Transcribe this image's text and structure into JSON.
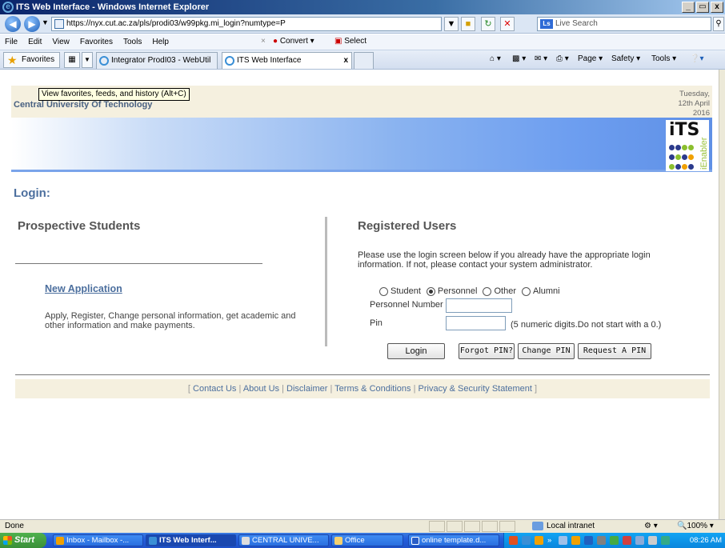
{
  "browser": {
    "title": "ITS Web Interface - Windows Internet Explorer",
    "window_buttons": [
      "_",
      "·",
      "x"
    ],
    "url": "https://nyx.cut.ac.za/pls/prodi03/w99pkg.mi_login?numtype=P",
    "search_placeholder": "Live Search",
    "menu": [
      "File",
      "Edit",
      "View",
      "Favorites",
      "Tools",
      "Help"
    ],
    "convert_label": "Convert",
    "select_label": "Select",
    "favorites_label": "Favorites",
    "tabs": [
      {
        "label": "Integrator ProdI03 - WebUtil"
      },
      {
        "label": "ITS Web Interface"
      }
    ],
    "tab_close": "x",
    "commands": [
      "Page",
      "Safety",
      "Tools"
    ],
    "tooltip": "View favorites, feeds, and history (Alt+C)"
  },
  "header": {
    "university": "Central University Of Technology",
    "date_line1": "Tuesday,",
    "date_line2": "12th April",
    "date_line3": "2016",
    "logo_text": "iTS",
    "logo_side": "iEnabler"
  },
  "login": {
    "title": "Login:",
    "prospective": {
      "title": "Prospective Students",
      "link": "New Application",
      "description": "Apply, Register, Change personal information, get academic and other information and make payments."
    },
    "registered": {
      "title": "Registered Users",
      "description": "Please use the login screen below if you already have the appropriate login information. If not, please contact your system administrator.",
      "roles": [
        {
          "label": "Student",
          "selected": false
        },
        {
          "label": "Personnel",
          "selected": true
        },
        {
          "label": "Other",
          "selected": false
        },
        {
          "label": "Alumni",
          "selected": false
        }
      ],
      "personnel_number_label": "Personnel Number",
      "personnel_number_value": "",
      "pin_label": "Pin",
      "pin_value": "",
      "pin_hint": "(5 numeric digits.Do not start with a 0.)",
      "buttons": {
        "login": "Login",
        "forgot_pin": "Forgot PIN?",
        "change_pin": "Change PIN",
        "request_pin": "Request A PIN"
      }
    }
  },
  "footer": {
    "open": "[",
    "close": "]",
    "links": [
      "Contact Us",
      "About Us",
      "Disclaimer",
      "Terms & Conditions",
      "Privacy & Security Statement"
    ]
  },
  "statusbar": {
    "status": "Done",
    "zone": "Local intranet",
    "zoom": "100%"
  },
  "taskbar": {
    "start": "Start",
    "tasks": [
      "Inbox - Mailbox -...",
      "ITS Web Interf...",
      "CENTRAL UNIVE...",
      "Office",
      "online template.d..."
    ],
    "clock": "08:26 AM"
  }
}
